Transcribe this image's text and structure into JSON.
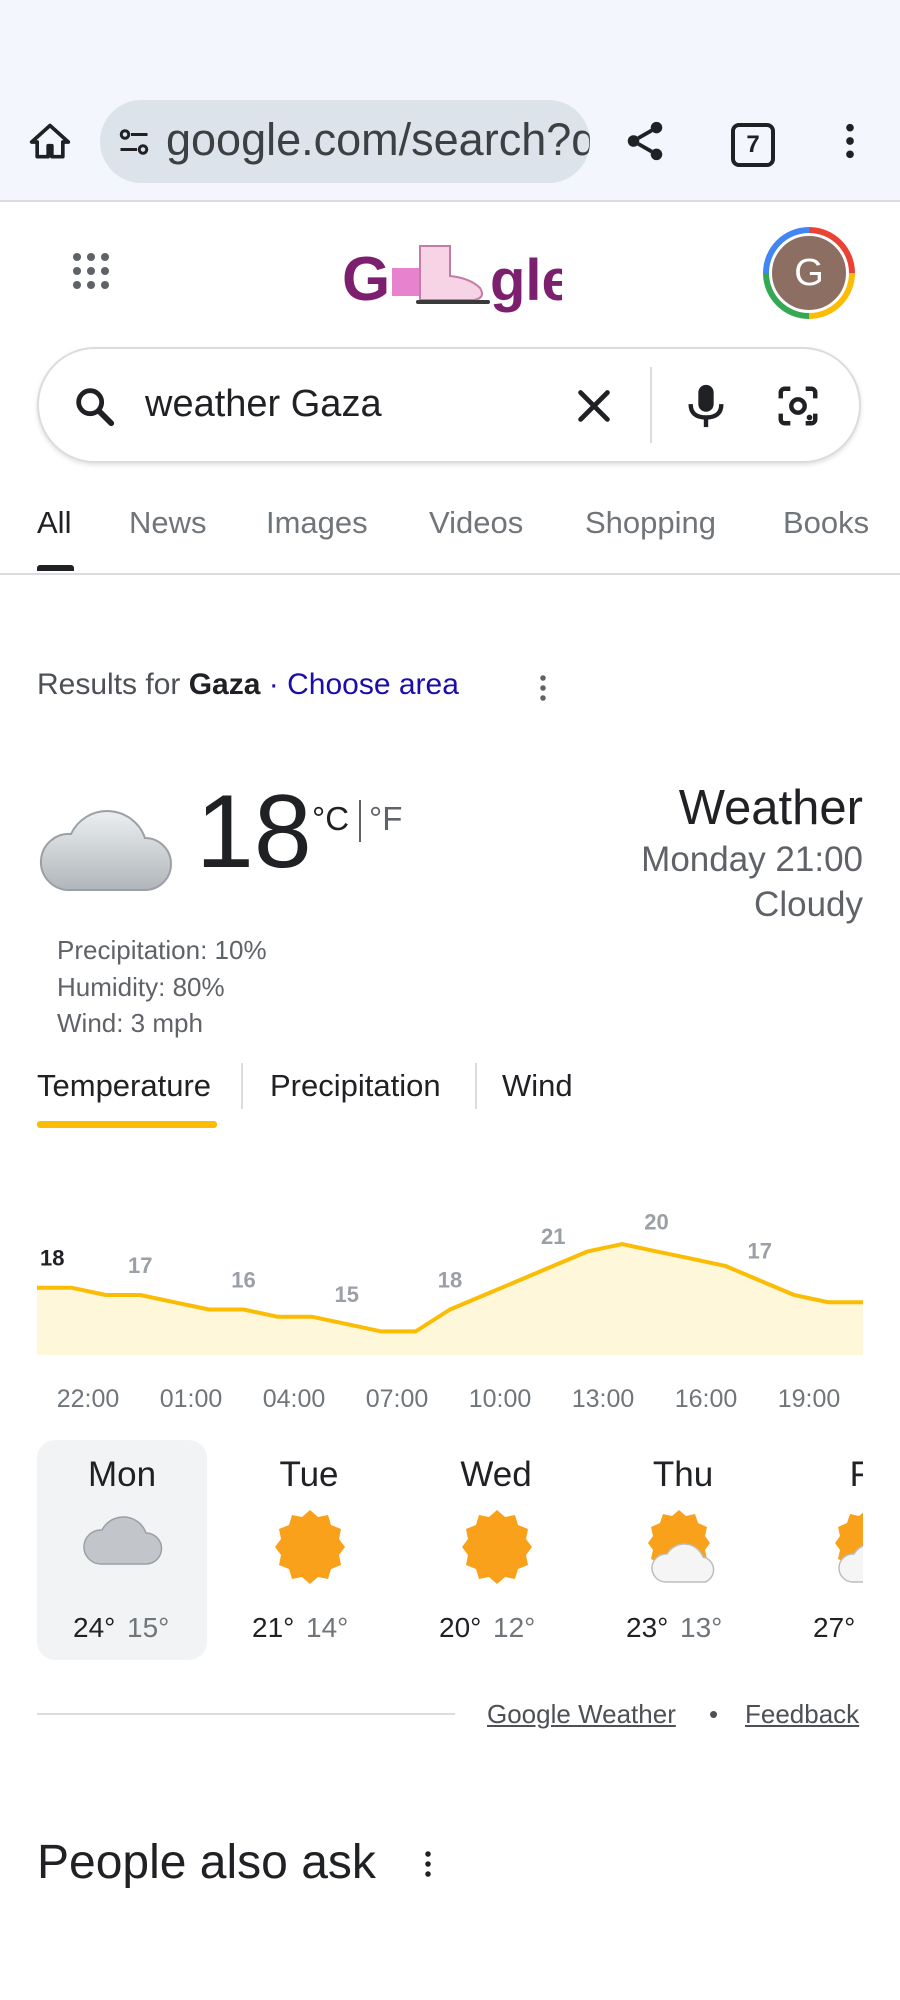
{
  "browser": {
    "url": "google.com/search?q",
    "tab_count": "7"
  },
  "header": {
    "avatar_initial": "G"
  },
  "search": {
    "query": "weather Gaza"
  },
  "tabs": [
    {
      "label": "All"
    },
    {
      "label": "News"
    },
    {
      "label": "Images"
    },
    {
      "label": "Videos"
    },
    {
      "label": "Shopping"
    },
    {
      "label": "Books"
    }
  ],
  "results_for": {
    "prefix": "Results for ",
    "location": "Gaza",
    "separator": " · ",
    "choose_area": "Choose area"
  },
  "weather": {
    "temperature": "18",
    "unit_c": "°C",
    "unit_f": "°F",
    "title": "Weather",
    "datetime": "Monday 21:00",
    "condition": "Cloudy",
    "precipitation": "Precipitation: 10%",
    "humidity": "Humidity: 80%",
    "wind": "Wind: 3 mph",
    "tabs": [
      "Temperature",
      "Precipitation",
      "Wind"
    ],
    "colors": {
      "line": "#fbbc04",
      "fill": "#fef7d9"
    }
  },
  "chart_data": {
    "type": "area",
    "x": [
      "21:00",
      "22:00",
      "23:00",
      "00:00",
      "01:00",
      "02:00",
      "03:00",
      "04:00",
      "05:00",
      "06:00",
      "07:00",
      "08:00",
      "09:00",
      "10:00",
      "11:00",
      "12:00",
      "13:00",
      "14:00",
      "15:00",
      "16:00",
      "17:00",
      "18:00",
      "19:00",
      "20:00",
      "21:00"
    ],
    "series": [
      {
        "values": [
          18,
          18,
          17.5,
          17.5,
          17,
          16.5,
          16.5,
          16,
          16,
          15.5,
          15,
          15,
          16.5,
          17.5,
          18.5,
          19.5,
          20.5,
          21,
          20.5,
          20,
          19.5,
          18.5,
          17.5,
          17,
          17
        ]
      }
    ],
    "labels": [
      {
        "text": "18",
        "index": 0
      },
      {
        "text": "17",
        "index": 3
      },
      {
        "text": "16",
        "index": 6
      },
      {
        "text": "15",
        "index": 9
      },
      {
        "text": "18",
        "index": 12
      },
      {
        "text": "21",
        "index": 15
      },
      {
        "text": "20",
        "index": 18
      },
      {
        "text": "17",
        "index": 21
      }
    ],
    "tick_labels": [
      "22:00",
      "01:00",
      "04:00",
      "07:00",
      "10:00",
      "13:00",
      "16:00",
      "19:00"
    ],
    "ylim": [
      12,
      23
    ]
  },
  "forecast": [
    {
      "day": "Mon",
      "hi": "24°",
      "lo": "15°",
      "icon": "cloudy-icon"
    },
    {
      "day": "Tue",
      "hi": "21°",
      "lo": "14°",
      "icon": "sunny-icon"
    },
    {
      "day": "Wed",
      "hi": "20°",
      "lo": "12°",
      "icon": "sunny-icon"
    },
    {
      "day": "Thu",
      "hi": "23°",
      "lo": "13°",
      "icon": "partly-cloudy-icon"
    },
    {
      "day": "Fri",
      "hi": "27°",
      "lo": "",
      "icon": "partly-cloudy-icon"
    }
  ],
  "footer": {
    "source": "Google Weather",
    "dot": "•",
    "feedback": "Feedback"
  },
  "people_also_ask": {
    "title": "People also ask"
  }
}
